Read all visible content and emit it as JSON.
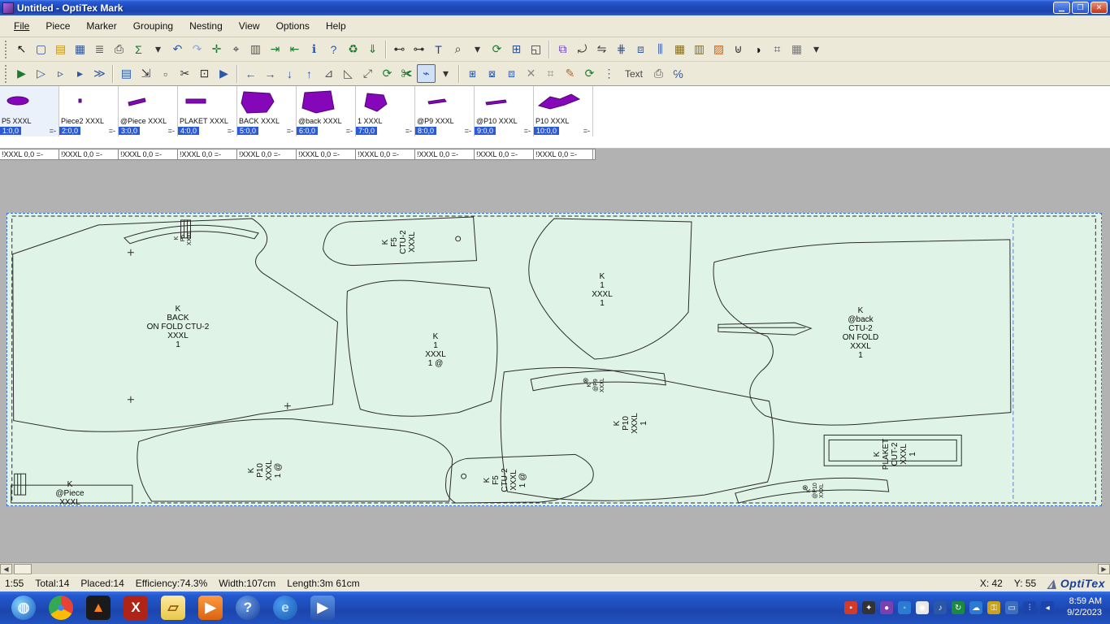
{
  "window": {
    "title": "Untitled - OptiTex Mark"
  },
  "menu": {
    "items": [
      "File",
      "Piece",
      "Marker",
      "Grouping",
      "Nesting",
      "View",
      "Options",
      "Help"
    ]
  },
  "toolbars": {
    "row1": [
      {
        "name": "select-tool",
        "glyph": "↖",
        "color": "#111"
      },
      {
        "name": "new-document",
        "glyph": "▢",
        "color": "#2b57a8"
      },
      {
        "name": "open-folder",
        "glyph": "▤",
        "color": "#c8941a"
      },
      {
        "name": "save",
        "glyph": "▦",
        "color": "#2b57a8"
      },
      {
        "name": "print-preview",
        "glyph": "≣",
        "color": "#555"
      },
      {
        "name": "print",
        "glyph": "⎙",
        "color": "#333"
      },
      {
        "name": "export-table",
        "glyph": "Σ",
        "color": "#1c7a2e"
      },
      {
        "name": "dropdown-arrow",
        "glyph": "▾",
        "color": "#333"
      },
      {
        "name": "undo",
        "glyph": "↶",
        "color": "#2b57a8"
      },
      {
        "name": "redo",
        "glyph": "↷",
        "color": "#8aa7d6"
      },
      {
        "name": "add-piece",
        "glyph": "✛",
        "color": "#1c7a2e"
      },
      {
        "name": "find-piece",
        "glyph": "⌖",
        "color": "#333"
      },
      {
        "name": "piece-report",
        "glyph": "▥",
        "color": "#555"
      },
      {
        "name": "import",
        "glyph": "⇥",
        "color": "#1c7a2e"
      },
      {
        "name": "export",
        "glyph": "⇤",
        "color": "#1c7a2e"
      },
      {
        "name": "info",
        "glyph": "ℹ",
        "color": "#2b57a8"
      },
      {
        "name": "context-help",
        "glyph": "?",
        "color": "#2b57a8"
      },
      {
        "name": "recycle",
        "glyph": "♻",
        "color": "#1c7a2e"
      },
      {
        "name": "send-down",
        "glyph": "⇓",
        "color": "#1c7a2e"
      },
      {
        "name": "divider"
      },
      {
        "name": "measure-length",
        "glyph": "⊷",
        "color": "#333"
      },
      {
        "name": "measure-height",
        "glyph": "⊶",
        "color": "#333"
      },
      {
        "name": "text-tool",
        "glyph": "T",
        "color": "#1c3fa0"
      },
      {
        "name": "zoom",
        "glyph": "⌕",
        "color": "#333"
      },
      {
        "name": "dropdown-arrow",
        "glyph": "▾",
        "color": "#333"
      },
      {
        "name": "refresh-view",
        "glyph": "⟳",
        "color": "#1c7a2e"
      },
      {
        "name": "zoom-window",
        "glyph": "⊞",
        "color": "#2b57a8"
      },
      {
        "name": "zoom-page",
        "glyph": "◱",
        "color": "#333"
      },
      {
        "name": "divider"
      },
      {
        "name": "marker-properties",
        "glyph": "⧉",
        "color": "#6a3fb0"
      },
      {
        "name": "rotate-piece",
        "glyph": "⤾",
        "color": "#333"
      },
      {
        "name": "flip-piece",
        "glyph": "⇋",
        "color": "#333"
      },
      {
        "name": "align-pieces",
        "glyph": "⋕",
        "color": "#2b57a8"
      },
      {
        "name": "distribute-pieces",
        "glyph": "⧈",
        "color": "#2b57a8"
      },
      {
        "name": "stack-pieces",
        "glyph": "⫼",
        "color": "#2b57a8"
      },
      {
        "name": "plaid-fabric",
        "glyph": "▦",
        "color": "#8a6d1a"
      },
      {
        "name": "stripe-fabric",
        "glyph": "▥",
        "color": "#8a6d1a"
      },
      {
        "name": "hatch-fabric",
        "glyph": "▨",
        "color": "#c8641a"
      },
      {
        "name": "magnet-snap",
        "glyph": "⊎",
        "color": "#333"
      },
      {
        "name": "shade-view",
        "glyph": "◑",
        "color": "#111"
      },
      {
        "name": "units-grid",
        "glyph": "⌗",
        "color": "#555"
      },
      {
        "name": "grid-view",
        "glyph": "▦",
        "color": "#777"
      },
      {
        "name": "dropdown-arrow",
        "glyph": "▾",
        "color": "#333"
      }
    ],
    "row2": [
      {
        "name": "nest-start",
        "glyph": "▶",
        "color": "#1c7a2e"
      },
      {
        "name": "nest-pause",
        "glyph": "▷",
        "color": "#2b57a8"
      },
      {
        "name": "nest-step",
        "glyph": "▹",
        "color": "#2b57a8"
      },
      {
        "name": "nest-end",
        "glyph": "▸",
        "color": "#2b57a8"
      },
      {
        "name": "nest-run-all",
        "glyph": "≫",
        "color": "#2b57a8"
      },
      {
        "name": "divider"
      },
      {
        "name": "strip-view",
        "glyph": "▤",
        "color": "#2b57a8"
      },
      {
        "name": "sort-pieces",
        "glyph": "⇲",
        "color": "#333"
      },
      {
        "name": "mini-nest",
        "glyph": "▫",
        "color": "#555"
      },
      {
        "name": "trim-cut",
        "glyph": "✂",
        "color": "#333"
      },
      {
        "name": "box-dimension",
        "glyph": "⊡",
        "color": "#333"
      },
      {
        "name": "play-right",
        "glyph": "▶",
        "color": "#2b57a8"
      },
      {
        "name": "divider"
      },
      {
        "name": "move-left",
        "glyph": "←",
        "color": "#2b57a8"
      },
      {
        "name": "move-right",
        "glyph": "→",
        "color": "#2b57a8"
      },
      {
        "name": "move-down",
        "glyph": "↓",
        "color": "#2b57a8"
      },
      {
        "name": "move-up",
        "glyph": "↑",
        "color": "#2b57a8"
      },
      {
        "name": "flip-horizontal",
        "glyph": "⊿",
        "color": "#555"
      },
      {
        "name": "flip-vertical",
        "glyph": "◺",
        "color": "#555"
      },
      {
        "name": "rotate-45",
        "glyph": "⤢",
        "color": "#555"
      },
      {
        "name": "rotate-90",
        "glyph": "⟳",
        "color": "#1c7a2e"
      },
      {
        "name": "snip-tool",
        "glyph": "✀",
        "color": "#1c7a2e"
      },
      {
        "name": "join-line",
        "glyph": "⌁",
        "color": "#2b57a8",
        "pressed": true
      },
      {
        "name": "dropdown-arrow",
        "glyph": "▾",
        "color": "#333"
      },
      {
        "name": "divider"
      },
      {
        "name": "nest-option-1",
        "glyph": "⧆",
        "color": "#2b57a8"
      },
      {
        "name": "nest-option-2",
        "glyph": "⧇",
        "color": "#2b57a8"
      },
      {
        "name": "nest-option-3",
        "glyph": "⧈",
        "color": "#2b57a8"
      },
      {
        "name": "delete-piece",
        "glyph": "✕",
        "color": "#888"
      },
      {
        "name": "cage-view",
        "glyph": "⌗",
        "color": "#888"
      },
      {
        "name": "edit-marker",
        "glyph": "✎",
        "color": "#c8641a"
      },
      {
        "name": "refresh-marker",
        "glyph": "⟳",
        "color": "#1c7a2e"
      },
      {
        "name": "step-pieces",
        "glyph": "⋮",
        "color": "#2b57a8"
      },
      {
        "name": "text-annotation",
        "glyph": "Text",
        "color": "#444",
        "text": true
      },
      {
        "name": "print-marker",
        "glyph": "⎙",
        "color": "#555"
      },
      {
        "name": "cut-percent",
        "glyph": "℅",
        "color": "#2b57a8"
      }
    ]
  },
  "pieces": [
    {
      "name": "P5 XXXL",
      "pos": "1:0,0",
      "suffix": "=-"
    },
    {
      "name": "Piece2 XXXL",
      "pos": "2:0,0",
      "suffix": "=-"
    },
    {
      "name": "@Piece XXXL",
      "pos": "3:0,0",
      "suffix": "=-"
    },
    {
      "name": "PLAKET XXXL",
      "pos": "4:0,0",
      "suffix": "=-"
    },
    {
      "name": "BACK XXXL",
      "pos": "5:0,0",
      "suffix": "=-"
    },
    {
      "name": "@back XXXL",
      "pos": "6:0,0",
      "suffix": "=-"
    },
    {
      "name": "1 XXXL",
      "pos": "7:0,0",
      "suffix": "=-"
    },
    {
      "name": "@P9 XXXL",
      "pos": "8:0,0",
      "suffix": "=-"
    },
    {
      "name": "@P10 XXXL",
      "pos": "9:0,0",
      "suffix": "=-"
    },
    {
      "name": "P10 XXXL",
      "pos": "10:0,0",
      "suffix": "=-"
    }
  ],
  "cells": [
    "!XXXL 0,0 =-",
    "!XXXL 0,0 =-",
    "!XXXL 0,0 =-",
    "!XXXL 0,0 =-",
    "!XXXL 0,0 =-",
    "!XXXL 0,0 =-",
    "!XXXL 0,0 =-",
    "!XXXL 0,0 =-",
    "!XXXL 0,0 =-",
    "!XXXL 0,0 =-"
  ],
  "marker": {
    "labels": [
      {
        "text": "K\nBACK\nON FOLD CTU-2\nXXXL\n1"
      },
      {
        "text": "K\nF5\nCTU-2\nXXXL"
      },
      {
        "text": "K\n1\nXXXL\n1"
      },
      {
        "text": "K\n1\nXXXL\n1 @"
      },
      {
        "text": "K\n@back\nCTU-2\nON FOLD\nXXXL\n1"
      },
      {
        "text": "K\nP10\nXXXL\n1"
      },
      {
        "text": "K\nP10\nXXXL\n1 @"
      },
      {
        "text": "K\n@Piece\nXXXL"
      },
      {
        "text": "K\nPLAKET\nCUT-2\nXXXL\n1"
      },
      {
        "text": "K\nF5\nCTU-2\nXXXL\n1 @"
      },
      {
        "text": "K\n@P9\nXXXL"
      },
      {
        "text": "K\n@P10\nXXXL"
      },
      {
        "text": "K\nP5\nXXXL"
      }
    ],
    "notch_symbol": "⊗"
  },
  "status": {
    "scale": "1:55",
    "total": "Total:14",
    "placed": "Placed:14",
    "efficiency": "Efficiency:74.3%",
    "width": "Width:107cm",
    "length": "Length:3m 61cm",
    "x_label": "X: 42",
    "y_label": "Y: 55",
    "logo": "OptiTex"
  },
  "taskbar": {
    "time": "8:59 AM",
    "date": "9/2/2023",
    "apps": [
      {
        "name": "start-globe",
        "glyph": "◍",
        "color": "#eaf4ff",
        "bg": "radial-gradient(circle at 35% 35%, #7fd0ff, #1c5dbf)"
      },
      {
        "name": "chrome",
        "glyph": "●",
        "color": "#4285f4",
        "bg": "conic-gradient(#ea4335 0 33%, #fbbc05 0 66%, #34a853 0 100%)"
      },
      {
        "name": "vlc",
        "glyph": "▲",
        "color": "#ff7f1a",
        "bg": "#1a1a1a"
      },
      {
        "name": "excel",
        "glyph": "X",
        "color": "#ffffff",
        "bg": "#b02418"
      },
      {
        "name": "folder",
        "glyph": "▱",
        "color": "#8a5a10",
        "bg": "linear-gradient(180deg,#ffe9a0,#e8c84a)"
      },
      {
        "name": "media-orange",
        "glyph": "▶",
        "color": "#ffffff",
        "bg": "linear-gradient(180deg,#ff9a40,#d86410)"
      },
      {
        "name": "help",
        "glyph": "?",
        "color": "#ffffff",
        "bg": "radial-gradient(circle at 35% 35%, #6aa0e8, #1c3f9a)"
      },
      {
        "name": "internet-explorer",
        "glyph": "e",
        "color": "#bfe2ff",
        "bg": "radial-gradient(circle at 35% 35%, #4a9af0, #155bb0)"
      },
      {
        "name": "media-player",
        "glyph": "▶",
        "color": "#ffffff",
        "bg": "linear-gradient(180deg,#5a90e0,#2a55b0)"
      }
    ],
    "tray": [
      {
        "name": "alert-shield",
        "glyph": "▪",
        "bg": "#d23a2a"
      },
      {
        "name": "gpu-settings",
        "glyph": "✦",
        "bg": "#333333"
      },
      {
        "name": "update-dot",
        "glyph": "●",
        "bg": "#7a3fb0"
      },
      {
        "name": "messenger",
        "glyph": "◦",
        "bg": "#2b7bd4"
      },
      {
        "name": "chrome-tray",
        "glyph": "◉",
        "bg": "#e8e8e8"
      },
      {
        "name": "volume",
        "glyph": "♪",
        "bg": "#2b57a8"
      },
      {
        "name": "sync",
        "glyph": "↻",
        "bg": "#1c8a3e"
      },
      {
        "name": "onedrive",
        "glyph": "☁",
        "bg": "#2b7bd4"
      },
      {
        "name": "security-key",
        "glyph": "⚿",
        "bg": "#caa21a"
      },
      {
        "name": "display",
        "glyph": "▭",
        "bg": "#3a6fc0"
      },
      {
        "name": "signal-bars",
        "glyph": "⫶",
        "bg": "#1c44ad"
      },
      {
        "name": "hide-icons",
        "glyph": "◂",
        "bg": "#1c44ad"
      }
    ]
  }
}
